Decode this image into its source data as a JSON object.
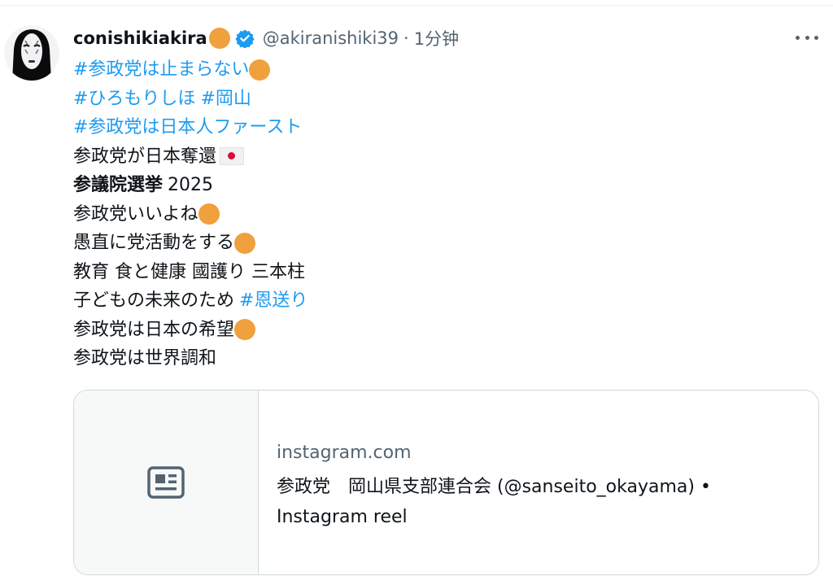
{
  "tweet": {
    "user": {
      "name": "conishikiakira",
      "handle": "@akiranishiki39",
      "separator": "·",
      "time": "1分钟",
      "verified": true
    },
    "lines": [
      [
        "#参政党は止まらない"
      ],
      [
        "#ひろもりしほ",
        "#岡山"
      ],
      [
        "#参政党は日本人ファースト"
      ],
      [
        "参政党が日本奪還"
      ],
      [
        "参議院選挙",
        "2025"
      ],
      [
        "参政党いいよね"
      ],
      [
        "愚直に党活動をする"
      ],
      [
        "教育 食と健康 國護り 三本柱"
      ],
      [
        "子どもの未来のため",
        "#恩送り"
      ],
      [
        "参政党は日本の希望"
      ],
      [
        "参政党は世界調和"
      ]
    ],
    "link_card": {
      "domain": "instagram.com",
      "title_line1": "参政党　岡山県支部連合会 (@sanseito_okayama) •",
      "title_line2": "Instagram reel",
      "icon": "article-icon"
    }
  },
  "colors": {
    "link": "#1d9bf0",
    "text": "#0f1419",
    "secondary": "#536471",
    "emoji_dot": "#f0a03c",
    "border": "#cfd9de"
  },
  "icons": {
    "avatar": "no-face-mask-avatar",
    "verified": "verified-badge-icon",
    "more": "more-options-icon",
    "flag": "japan-flag-emoji",
    "dot": "orange-circle-emoji"
  }
}
